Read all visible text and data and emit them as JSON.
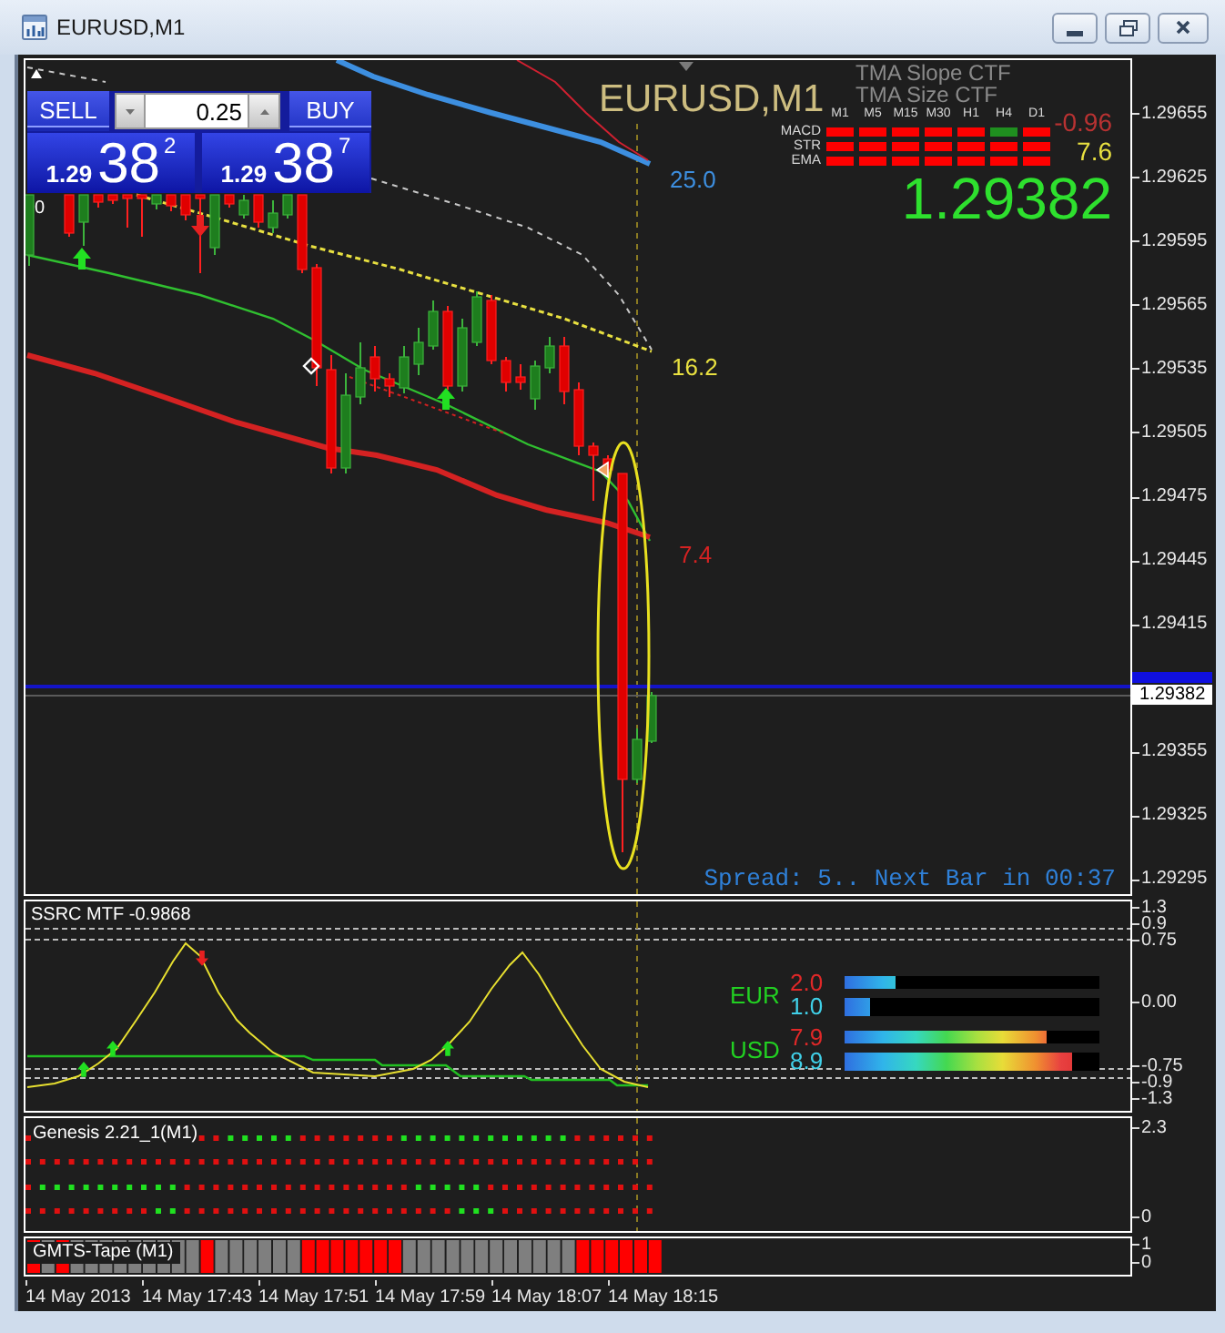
{
  "window": {
    "title": "EURUSD,M1"
  },
  "trade_panel": {
    "sell_button": "SELL",
    "lot_field": {
      "value": "0.25"
    },
    "buy_button": "BUY",
    "sell_quote": {
      "big_figure": "1.29",
      "pips": "38",
      "fraction": "2"
    },
    "buy_quote": {
      "big_figure": "1.29",
      "pips": "38",
      "fraction": "7"
    }
  },
  "price_chart": {
    "symbol_label": "EURUSD,M1",
    "edge_label": "0",
    "line_labels": [
      {
        "text": "25.0",
        "color": "#3d8fe0"
      },
      {
        "text": "16.2",
        "color": "#e8e040"
      },
      {
        "text": "7.4",
        "color": "#d42222"
      }
    ],
    "indicator_captions": [
      "TMA Slope CTF",
      "TMA Size CTF"
    ],
    "trend_table": {
      "timeframes": [
        "M1",
        "M5",
        "M15",
        "M30",
        "H1",
        "H4",
        "D1"
      ],
      "rows": [
        {
          "label": "MACD",
          "cells": [
            {
              "color": "#ff0000"
            },
            {
              "color": "#ff0000"
            },
            {
              "color": "#ff0000"
            },
            {
              "color": "#ff0000"
            },
            {
              "color": "#ff0000"
            },
            {
              "color": "#1f8f1f"
            },
            {
              "color": "#ff0000"
            }
          ]
        },
        {
          "label": "STR",
          "cells": [
            {
              "color": "#ff0000"
            },
            {
              "color": "#ff0000"
            },
            {
              "color": "#ff0000"
            },
            {
              "color": "#ff0000"
            },
            {
              "color": "#ff0000"
            },
            {
              "color": "#ff0000"
            },
            {
              "color": "#ff0000"
            }
          ]
        },
        {
          "label": "EMA",
          "cells": [
            {
              "color": "#ff0000"
            },
            {
              "color": "#ff0000"
            },
            {
              "color": "#ff0000"
            },
            {
              "color": "#ff0000"
            },
            {
              "color": "#ff0000"
            },
            {
              "color": "#ff0000"
            },
            {
              "color": "#ff0000"
            }
          ]
        }
      ]
    },
    "indicator_readings": [
      {
        "text": "-0.96",
        "color": "#b83232"
      },
      {
        "text": "7.6",
        "color": "#e8e040"
      }
    ],
    "last_price": "1.29382",
    "status_text": "Spread: 5.. Next Bar in 00:37"
  },
  "price_axis": {
    "labels": [
      "1.29655",
      "1.29625",
      "1.29595",
      "1.29565",
      "1.29535",
      "1.29505",
      "1.29475",
      "1.29445",
      "1.29415",
      "1.29355",
      "1.29325",
      "1.29295"
    ],
    "current_price": "1.29382"
  },
  "ssrc_panel": {
    "title": "SSRC MTF -0.9868",
    "axis_labels": [
      "1.3",
      "0.9",
      "0.75",
      "0.00",
      "-0.75",
      "-0.9",
      "-1.3"
    ],
    "strength_meter": [
      {
        "currency": "EUR",
        "bars": [
          {
            "kind": "thin",
            "reading": "2.0",
            "color": "#e02828",
            "level": 0.2
          },
          {
            "kind": "thick",
            "reading": "1.0",
            "color": "#40d0e8",
            "level": 0.1
          }
        ]
      },
      {
        "currency": "USD",
        "bars": [
          {
            "kind": "thin",
            "reading": "7.9",
            "color": "#e02828",
            "level": 0.79
          },
          {
            "kind": "thick",
            "reading": "8.9",
            "color": "#40d0e8",
            "level": 0.89
          }
        ]
      }
    ]
  },
  "genesis_panel": {
    "title": "Genesis 2.21_1(M1)",
    "axis_labels": [
      "2.3",
      "0"
    ]
  },
  "tape_panel": {
    "title": "GMTS-Tape (M1)",
    "axis_labels": [
      "1",
      "0"
    ]
  },
  "time_axis": {
    "labels": [
      "14 May 2013",
      "14 May 17:43",
      "14 May 17:51",
      "14 May 17:59",
      "14 May 18:07",
      "14 May 18:15"
    ]
  }
}
